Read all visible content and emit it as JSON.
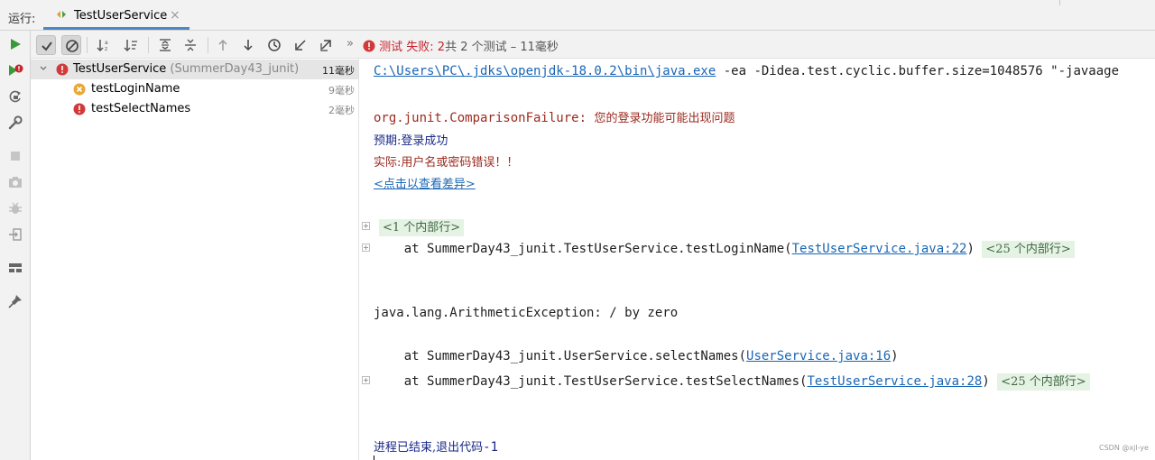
{
  "tabbar": {
    "run_label": "运行:",
    "tab_label": "TestUserService",
    "close_glyph": "×"
  },
  "toolbar": {
    "more_glyph": "»",
    "status_fail": "测试 失败: 2",
    "status_rest": "共 2 个测试 – 11毫秒"
  },
  "tree": {
    "root": {
      "label": "TestUserService",
      "sub": " (SummerDay43_junit)",
      "duration": "11毫秒"
    },
    "items": [
      {
        "label": "testLoginName",
        "duration": "9毫秒",
        "status": "failed-assertion"
      },
      {
        "label": "testSelectNames",
        "duration": "2毫秒",
        "status": "error"
      }
    ]
  },
  "console": {
    "cmd_path": "C:\\Users\\PC\\.jdks\\openjdk-18.0.2\\bin\\java.exe",
    "cmd_args": " -ea -Didea.test.cyclic.buffer.size=1048576 \"-javaage",
    "failure_type": "org.junit.ComparisonFailure: ",
    "failure_msg": "您的登录功能可能出现问题",
    "expected": "预期:登录成功",
    "actual": "实际:用户名或密码错误！！",
    "diff_link": "<点击以查看差异>",
    "fold1": "<1 个内部行>",
    "trace1_prefix": "    at SummerDay43_junit.TestUserService.testLoginName(",
    "trace1_link": "TestUserService.java:22",
    "trace1_suffix": ")",
    "fold2": "<25 个内部行>",
    "exception": "java.lang.ArithmeticException: / by zero",
    "trace2_prefix": "    at SummerDay43_junit.UserService.selectNames(",
    "trace2_link": "UserService.java:16",
    "trace2_suffix": ")",
    "trace3_prefix": "    at SummerDay43_junit.TestUserService.testSelectNames(",
    "trace3_link": "TestUserService.java:28",
    "trace3_suffix": ")",
    "fold3": "<25 个内部行>",
    "exit": "进程已结束,退出代码",
    "exit_code": "-1"
  },
  "watermark": "CSDN @xjl-ye",
  "colors": {
    "accent": "#4a88c7",
    "fail": "#c7222d",
    "link": "#1a66b5",
    "run": "#3a9a3a"
  },
  "icons": {
    "left": [
      "run-icon",
      "rerun-failed-icon",
      "rerun-icon",
      "wrench-icon",
      "stop-icon",
      "camera-icon",
      "debug-icon",
      "exit-icon",
      "layout-icon",
      "pin-icon"
    ],
    "top": [
      "show-passed-icon",
      "show-ignored-icon",
      "sort-alpha-icon",
      "sort-duration-icon",
      "expand-all-icon",
      "collapse-all-icon",
      "prev-failed-icon",
      "next-failed-icon",
      "history-icon",
      "import-icon",
      "export-icon"
    ]
  }
}
